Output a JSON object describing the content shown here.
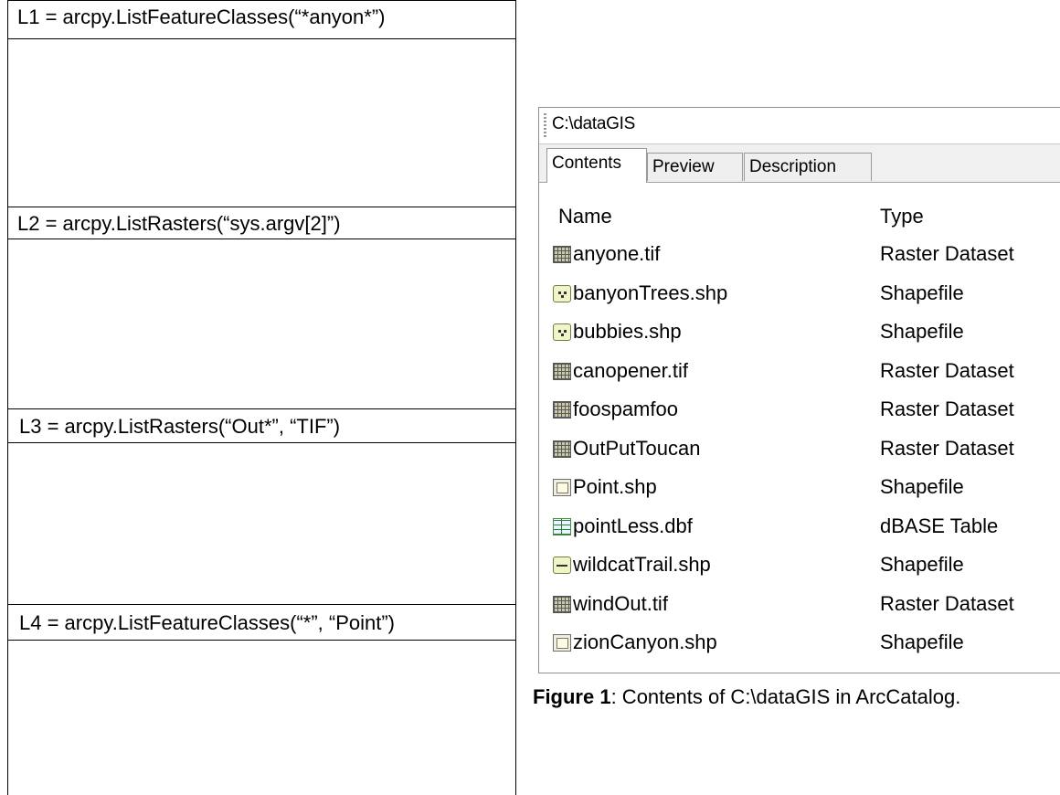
{
  "questions": [
    {
      "code": "L1 = arcpy.ListFeatureClasses(“*anyon*”)"
    },
    {
      "code": "L2 = arcpy.ListRasters(“sys.argv[2]”)"
    },
    {
      "code": "L3 = arcpy.ListRasters(“Out*”, “TIF”)"
    },
    {
      "code": "L4 = arcpy.ListFeatureClasses(“*”, “Point”)"
    }
  ],
  "catalog": {
    "path": "C:\\dataGIS",
    "tabs": [
      "Contents",
      "Preview",
      "Description"
    ],
    "active_tab": "Contents",
    "columns": {
      "name": "Name",
      "type": "Type"
    },
    "items": [
      {
        "name": "anyone.tif",
        "type": "Raster Dataset",
        "icon": "raster-icon"
      },
      {
        "name": "banyonTrees.shp",
        "type": "Shapefile",
        "icon": "point-shapefile-icon"
      },
      {
        "name": "bubbies.shp",
        "type": "Shapefile",
        "icon": "point-shapefile-icon"
      },
      {
        "name": "canopener.tif",
        "type": "Raster Dataset",
        "icon": "raster-icon"
      },
      {
        "name": "foospamfoo",
        "type": "Raster Dataset",
        "icon": "raster-icon"
      },
      {
        "name": "OutPutToucan",
        "type": "Raster Dataset",
        "icon": "raster-icon"
      },
      {
        "name": "Point.shp",
        "type": "Shapefile",
        "icon": "polygon-shapefile-icon"
      },
      {
        "name": "pointLess.dbf",
        "type": "dBASE Table",
        "icon": "table-icon"
      },
      {
        "name": "wildcatTrail.shp",
        "type": "Shapefile",
        "icon": "line-shapefile-icon"
      },
      {
        "name": "windOut.tif",
        "type": "Raster Dataset",
        "icon": "raster-icon"
      },
      {
        "name": "zionCanyon.shp",
        "type": "Shapefile",
        "icon": "polygon-shapefile-icon"
      }
    ]
  },
  "caption": {
    "label": "Figure 1",
    "text": ": Contents of C:\\dataGIS in ArcCatalog."
  }
}
